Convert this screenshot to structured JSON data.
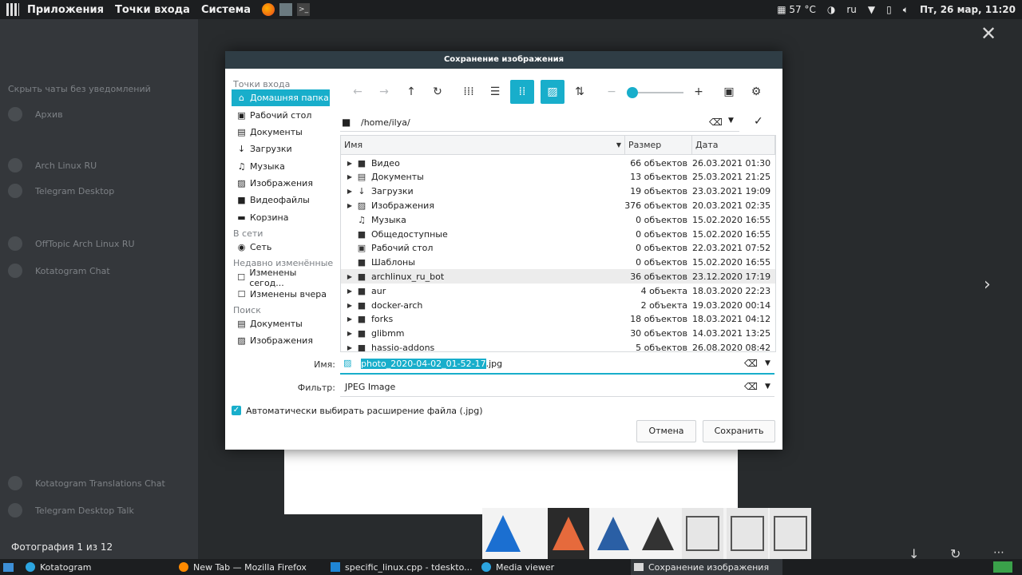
{
  "top_panel": {
    "menus": [
      "Приложения",
      "Точки входа",
      "Система"
    ],
    "temperature": "57 °C",
    "keyboard_layout": "ru",
    "clock": "Пт, 26 мар, 11:20"
  },
  "dialog": {
    "title": "Сохранение изображения",
    "places": {
      "section_places": "Точки входа",
      "items_places": [
        {
          "label": "Домашняя папка",
          "icon": "home-icon"
        },
        {
          "label": "Рабочий стол",
          "icon": "desktop-icon"
        },
        {
          "label": "Документы",
          "icon": "document-icon"
        },
        {
          "label": "Загрузки",
          "icon": "download-icon"
        },
        {
          "label": "Музыка",
          "icon": "music-icon"
        },
        {
          "label": "Изображения",
          "icon": "image-icon"
        },
        {
          "label": "Видеофайлы",
          "icon": "video-icon"
        },
        {
          "label": "Корзина",
          "icon": "trash-icon"
        }
      ],
      "section_network": "В сети",
      "items_network": [
        {
          "label": "Сеть",
          "icon": "network-icon"
        }
      ],
      "section_recent": "Недавно изменённые",
      "items_recent": [
        {
          "label": "Изменены сегод...",
          "icon": "calendar-icon"
        },
        {
          "label": "Изменены вчера",
          "icon": "calendar-icon"
        }
      ],
      "section_search": "Поиск",
      "items_search": [
        {
          "label": "Документы",
          "icon": "document-icon"
        },
        {
          "label": "Изображения",
          "icon": "image-icon"
        }
      ]
    },
    "path": "/home/ilya/",
    "columns": {
      "name": "Имя",
      "size": "Размер",
      "date": "Дата"
    },
    "files": [
      {
        "name": "Видео",
        "size": "66 объектов",
        "date": "26.03.2021 01:30",
        "icon": "video-folder-icon",
        "expandable": true
      },
      {
        "name": "Документы",
        "size": "13 объектов",
        "date": "25.03.2021 21:25",
        "icon": "document-folder-icon",
        "expandable": true
      },
      {
        "name": "Загрузки",
        "size": "19 объектов",
        "date": "23.03.2021 19:09",
        "icon": "download-folder-icon",
        "expandable": true
      },
      {
        "name": "Изображения",
        "size": "376 объектов",
        "date": "20.03.2021 02:35",
        "icon": "image-folder-icon",
        "expandable": true
      },
      {
        "name": "Музыка",
        "size": "0 объектов",
        "date": "15.02.2020 16:55",
        "icon": "music-folder-icon",
        "expandable": false
      },
      {
        "name": "Общедоступные",
        "size": "0 объектов",
        "date": "15.02.2020 16:55",
        "icon": "folder-icon",
        "expandable": false
      },
      {
        "name": "Рабочий стол",
        "size": "0 объектов",
        "date": "22.03.2021 07:52",
        "icon": "desktop-folder-icon",
        "expandable": false
      },
      {
        "name": "Шаблоны",
        "size": "0 объектов",
        "date": "15.02.2020 16:55",
        "icon": "folder-icon",
        "expandable": false
      },
      {
        "name": "archlinux_ru_bot",
        "size": "36 объектов",
        "date": "23.12.2020 17:19",
        "icon": "folder-icon",
        "expandable": true,
        "highlight": true
      },
      {
        "name": "aur",
        "size": "4 объекта",
        "date": "18.03.2020 22:23",
        "icon": "folder-icon",
        "expandable": true
      },
      {
        "name": "docker-arch",
        "size": "2 объекта",
        "date": "19.03.2020 00:14",
        "icon": "folder-icon",
        "expandable": true
      },
      {
        "name": "forks",
        "size": "18 объектов",
        "date": "18.03.2021 04:12",
        "icon": "folder-icon",
        "expandable": true
      },
      {
        "name": "glibmm",
        "size": "30 объектов",
        "date": "14.03.2021 13:25",
        "icon": "folder-icon",
        "expandable": true
      },
      {
        "name": "hassio-addons",
        "size": "5 объектов",
        "date": "26.08.2020 08:42",
        "icon": "folder-icon",
        "expandable": true
      }
    ],
    "name_label": "Имя:",
    "filename_selected": "photo_2020-04-02_01-52-17",
    "filename_ext": ".jpg",
    "filter_label": "Фильтр:",
    "filter_value": "JPEG Image",
    "auto_ext_label": "Автоматически выбирать расширение файла (.jpg)",
    "cancel_label": "Отмена",
    "save_label": "Сохранить"
  },
  "background": {
    "photo_counter": "Фотография 1 из 12",
    "chats": [
      "Скрыть чаты без уведомлений",
      "Архив",
      "Arch Linux RU",
      "Telegram Desktop",
      "OffTopic Arch Linux RU",
      "Kotatogram Chat",
      "Kotatogram Translations Chat",
      "Telegram Desktop Talk"
    ]
  },
  "taskbar": {
    "tasks": [
      {
        "label": "Kotatogram",
        "icon": "telegram-icon"
      },
      {
        "label": "New Tab — Mozilla Firefox",
        "icon": "firefox-icon"
      },
      {
        "label": "specific_linux.cpp - tdeskto...",
        "icon": "vscode-icon"
      },
      {
        "label": "Media viewer",
        "icon": "telegram-icon"
      },
      {
        "label": "Сохранение изображения",
        "icon": "window-icon"
      }
    ]
  },
  "colors": {
    "accent": "#18aecb",
    "title_bar": "#2f3d45",
    "panel": "#1c1e20"
  }
}
